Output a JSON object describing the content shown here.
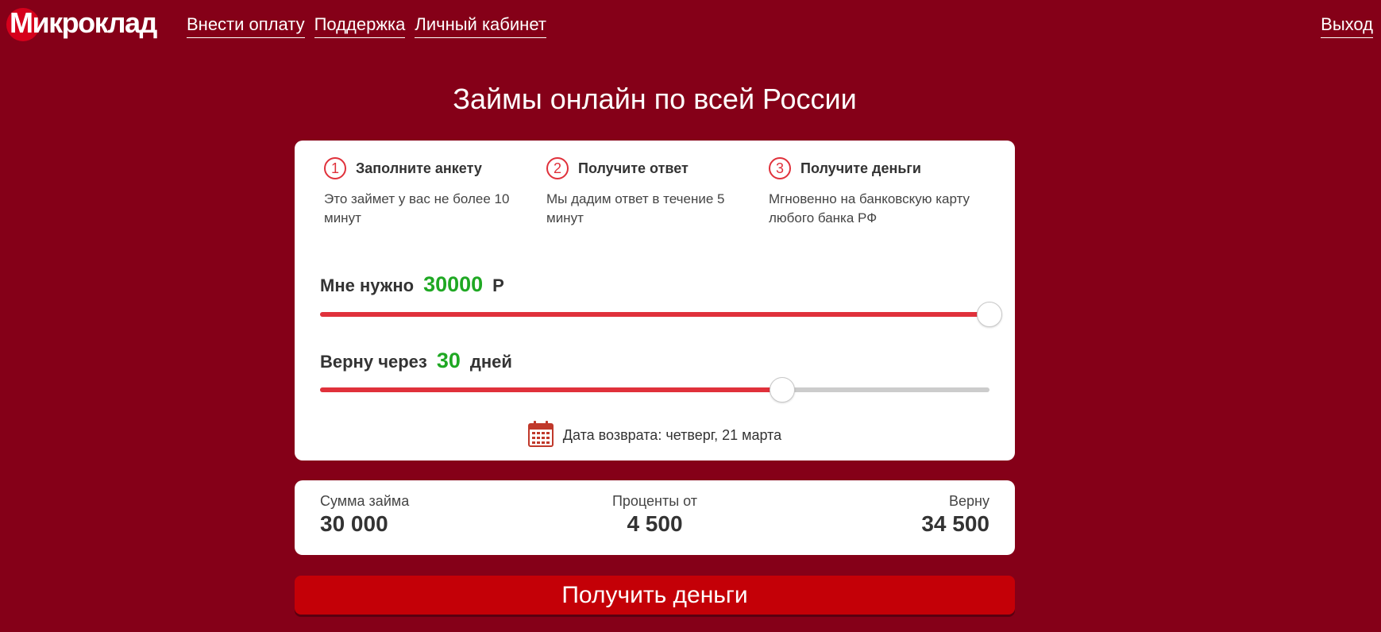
{
  "header": {
    "logo_text": "Микроклад",
    "nav": [
      "Внести оплату",
      "Поддержка",
      "Личный кабинет"
    ],
    "logout": "Выход"
  },
  "headline": "Займы онлайн по всей России",
  "steps": [
    {
      "num": "1",
      "title": "Заполните анкету",
      "desc": "Это займет у вас не более 10 минут"
    },
    {
      "num": "2",
      "title": "Получите ответ",
      "desc": "Мы дадим ответ в течение 5 минут"
    },
    {
      "num": "3",
      "title": "Получите деньги",
      "desc": "Мгновенно на банковскую карту любого банка РФ"
    }
  ],
  "amount_slider": {
    "label": "Мне нужно",
    "value": "30000",
    "unit": "Р",
    "fill_fraction": 1.0
  },
  "term_slider": {
    "label": "Верну через",
    "value": "30",
    "unit": "дней",
    "fill_fraction": 0.69
  },
  "return_date": {
    "icon": "calendar-icon",
    "text": "Дата возврата: четверг, 21 марта"
  },
  "summary": {
    "loan_label": "Сумма займа",
    "loan_value": "30 000",
    "interest_label": "Проценты от",
    "interest_value": "4 500",
    "repay_label": "Верну",
    "repay_value": "34 500"
  },
  "cta_label": "Получить деньги",
  "colors": {
    "background": "#850018",
    "accent": "#e0313b",
    "value_green": "#1fa823",
    "button": "#c40007"
  }
}
